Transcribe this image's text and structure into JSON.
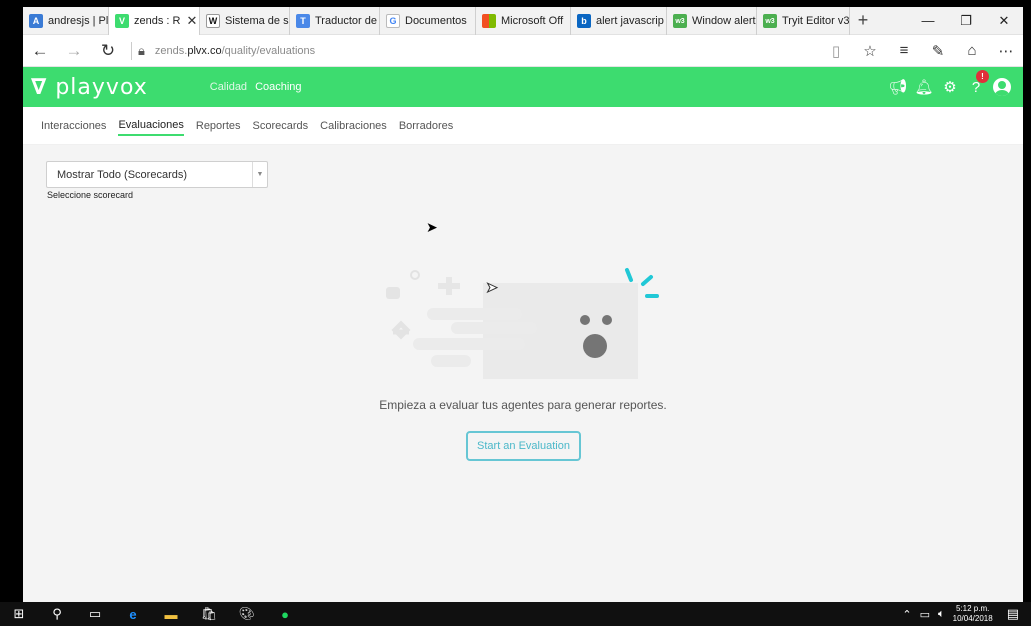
{
  "browser": {
    "tabs": [
      {
        "label": "andresjs | Pla",
        "fav_color": "#3a7bd5",
        "fav_glyph": "A"
      },
      {
        "label": "zends : R",
        "fav_color": "#3ddc6f",
        "fav_glyph": "V",
        "active": true
      },
      {
        "label": "Sistema de s",
        "fav_color": "#ffffff",
        "fav_glyph": "W"
      },
      {
        "label": "Traductor de",
        "fav_color": "#4a88e8",
        "fav_glyph": "T"
      },
      {
        "label": "Documentos",
        "fav_color": "#ffffff",
        "fav_glyph": "G"
      },
      {
        "label": "Microsoft Off",
        "fav_color": "#e3582a",
        "fav_glyph": "■"
      },
      {
        "label": "alert javascrip",
        "fav_color": "#0a66c2",
        "fav_glyph": "b"
      },
      {
        "label": "Window alert",
        "fav_color": "#4caf50",
        "fav_glyph": "w3"
      },
      {
        "label": "Tryit Editor v3",
        "fav_color": "#4caf50",
        "fav_glyph": "w3"
      }
    ],
    "url_prefix": "zends.",
    "url_domain": "plvx.co",
    "url_path": "/quality/evaluations"
  },
  "app": {
    "logo": "playvox",
    "nav": [
      "Calidad",
      "Coaching"
    ],
    "notification_badge": "!"
  },
  "subnav": [
    "Interacciones",
    "Evaluaciones",
    "Reportes",
    "Scorecards",
    "Calibraciones",
    "Borradores"
  ],
  "filter": {
    "selected": "Mostrar Todo (Scorecards)",
    "hint": "Seleccione scorecard"
  },
  "empty_state": {
    "message": "Empieza a evaluar tus agentes para generar reportes.",
    "button": "Start an Evaluation"
  },
  "taskbar": {
    "time": "5:12 p.m.",
    "date": "10/04/2018"
  },
  "colors": {
    "brand_green": "#3ddc6f",
    "accent_teal": "#4cb8c9"
  }
}
